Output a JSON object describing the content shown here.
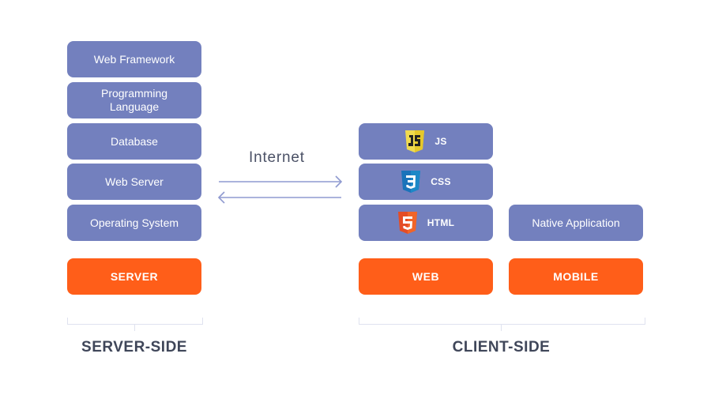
{
  "server": {
    "layers": [
      {
        "label": "Web Framework"
      },
      {
        "label": "Programming Language"
      },
      {
        "label": "Database"
      },
      {
        "label": "Web Server"
      },
      {
        "label": "Operating System"
      }
    ],
    "base_label": "SERVER",
    "side_label": "SERVER-SIDE"
  },
  "connection": {
    "label": "Internet",
    "arrow_color": "#8f9ad0"
  },
  "client": {
    "web": {
      "layers": [
        {
          "label": "JS",
          "icon": "js-shield-icon",
          "color": "#f0db4f"
        },
        {
          "label": "CSS",
          "icon": "css3-shield-icon",
          "color": "#1b73ba"
        },
        {
          "label": "HTML",
          "icon": "html5-shield-icon",
          "color": "#e44d26"
        }
      ],
      "base_label": "WEB"
    },
    "mobile": {
      "layers": [
        {
          "label": "Native Application"
        }
      ],
      "base_label": "MOBILE"
    },
    "side_label": "CLIENT-SIDE"
  },
  "colors": {
    "layer": "#7380be",
    "base": "#ff5e19",
    "heading": "#3f4659"
  }
}
